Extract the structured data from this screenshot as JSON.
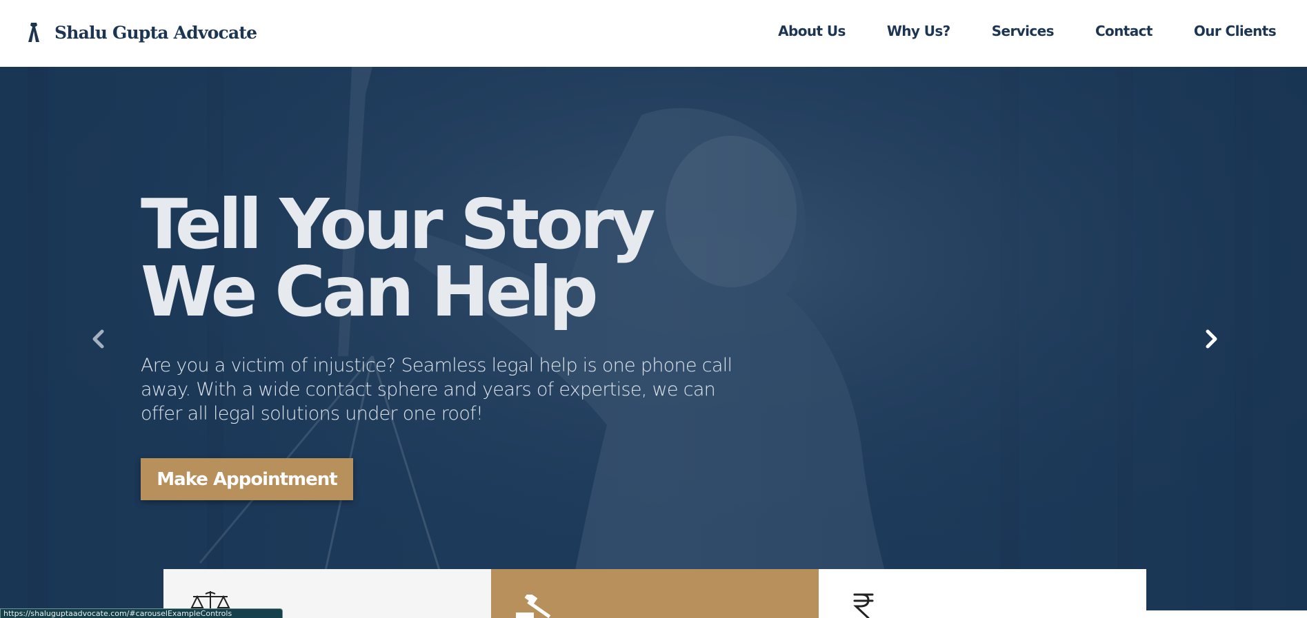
{
  "header": {
    "brand_name": "Shalu Gupta Advocate",
    "brand_icon": "advocate-band-icon",
    "nav": [
      {
        "label": "About Us"
      },
      {
        "label": "Why Us?"
      },
      {
        "label": "Services"
      },
      {
        "label": "Contact"
      },
      {
        "label": "Our Clients"
      }
    ]
  },
  "hero": {
    "title": "Tell Your Story We Can Help",
    "description": "Are you a victim of injustice? Seamless legal help is one phone call away. With a wide contact sphere and years of expertise, we can offer all legal solutions under one roof!",
    "cta_label": "Make Appointment",
    "prev_icon": "chevron-left-icon",
    "next_icon": "chevron-right-icon"
  },
  "cards": [
    {
      "icon": "scales-icon"
    },
    {
      "icon": "gavel-icon"
    },
    {
      "icon": "rupee-icon"
    }
  ],
  "status_bar": {
    "url": "https://shaluguptaadvocate.com/#carouselExampleControls"
  },
  "colors": {
    "primary_navy": "#1c3553",
    "hero_bg": "#1e3a5a",
    "accent_gold": "#b8905c",
    "hero_text": "#e6eaee"
  }
}
